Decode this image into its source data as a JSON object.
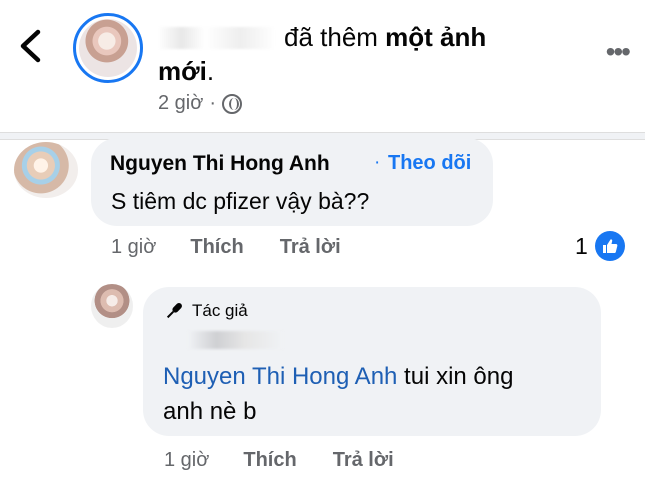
{
  "post": {
    "action_mid": "đã thêm ",
    "action_bold": "một ảnh",
    "action_line2": "mới",
    "period": ".",
    "time": "2 giờ",
    "dot": "·",
    "privacy_icon": "globe-icon"
  },
  "comments": [
    {
      "author": "Nguyen Thi Hong Anh",
      "dot": "·",
      "follow_label": "Theo dõi",
      "text": "S tiêm dc pfizer vậy bà??",
      "time": "1 giờ",
      "like_label": "Thích",
      "reply_label": "Trả lời",
      "reaction_count": "1",
      "reaction_icon": "like-icon"
    },
    {
      "badge": "Tác giả",
      "badge_icon": "microphone-icon",
      "mention": "Nguyen Thi Hong Anh",
      "text_line1": " tui xin ông",
      "text_line2": "anh nè b",
      "time": "1 giờ",
      "like_label": "Thích",
      "reply_label": "Trả lời"
    }
  ],
  "colors": {
    "accent": "#1877f2",
    "bubble": "#f0f2f5",
    "secondary_text": "#65676b",
    "primary_text": "#050505"
  }
}
